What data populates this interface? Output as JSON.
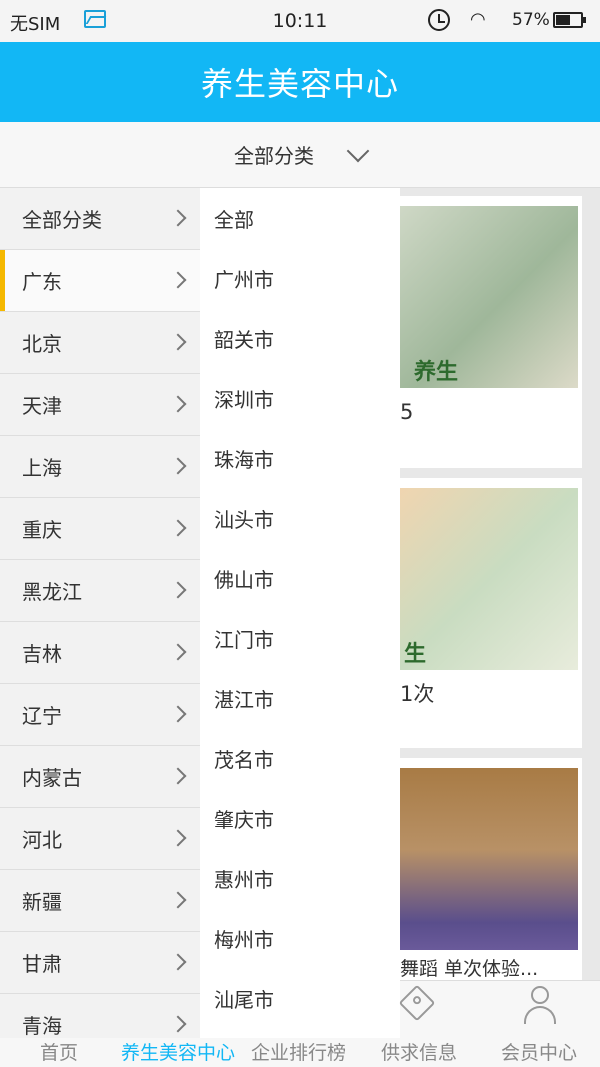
{
  "status_bar": {
    "sim": "无SIM",
    "time": "10:11",
    "battery": "57%",
    "battery_level": 0.57
  },
  "header": {
    "title": "养生美容中心"
  },
  "filter": {
    "label": "全部分类"
  },
  "provinces": [
    {
      "label": "全部分类"
    },
    {
      "label": "广东",
      "active": true
    },
    {
      "label": "北京"
    },
    {
      "label": "天津"
    },
    {
      "label": "上海"
    },
    {
      "label": "重庆"
    },
    {
      "label": "黑龙江"
    },
    {
      "label": "吉林"
    },
    {
      "label": "辽宁"
    },
    {
      "label": "内蒙古"
    },
    {
      "label": "河北"
    },
    {
      "label": "新疆"
    },
    {
      "label": "甘肃"
    },
    {
      "label": "青海"
    }
  ],
  "cities": [
    "全部",
    "广州市",
    "韶关市",
    "深圳市",
    "珠海市",
    "汕头市",
    "佛山市",
    "江门市",
    "湛江市",
    "茂名市",
    "肇庆市",
    "惠州市",
    "梅州市",
    "汕尾市"
  ],
  "cards": [
    {
      "tag": "养生",
      "text": "5"
    },
    {
      "tag": "生",
      "text": "1次"
    },
    {
      "tag": "",
      "text": "舞蹈 单次体验..."
    }
  ],
  "bottom_nav": [
    {
      "label": "首页"
    },
    {
      "label": "养生美容中心",
      "active": true
    },
    {
      "label": "企业排行榜"
    },
    {
      "label": "供求信息"
    },
    {
      "label": "会员中心"
    }
  ],
  "colors": {
    "accent": "#12b7f5",
    "active_marker": "#f5b800"
  }
}
